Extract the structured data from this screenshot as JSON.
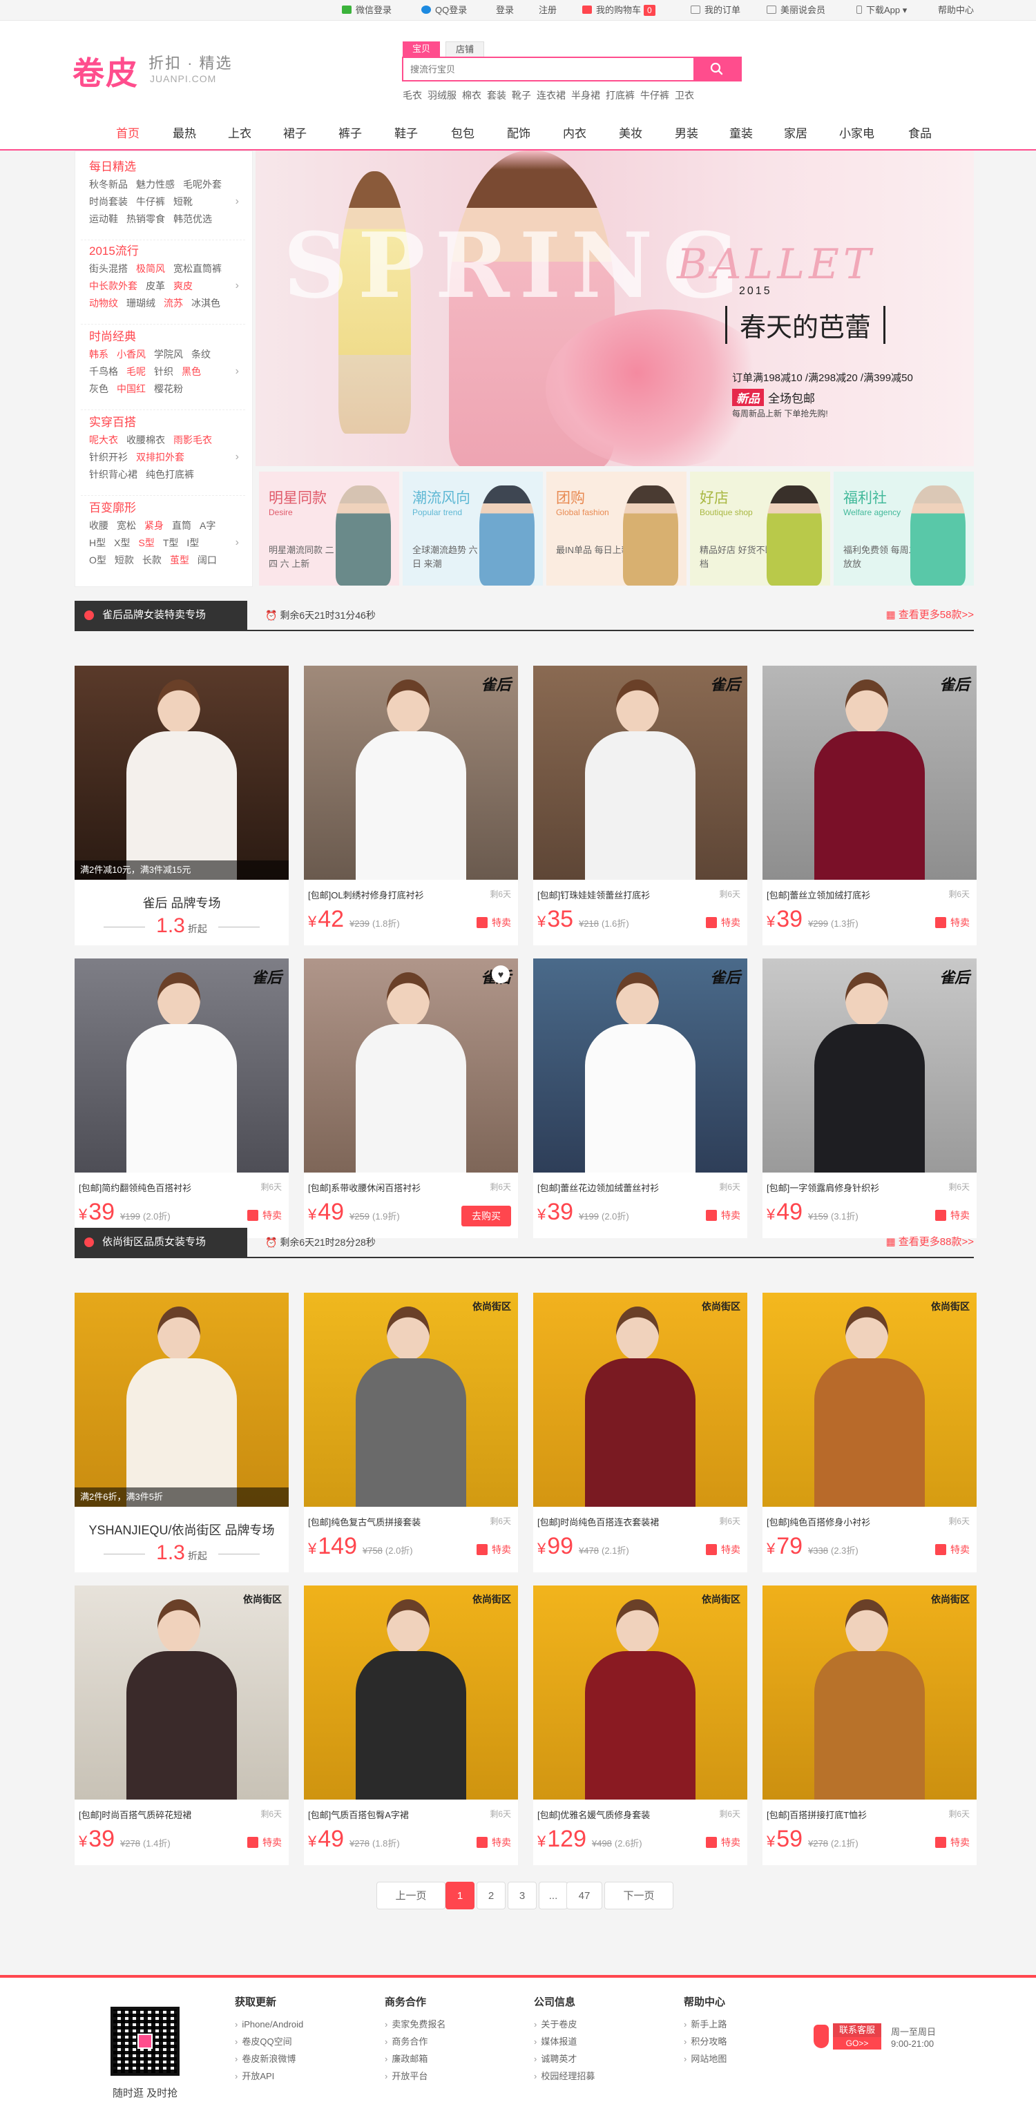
{
  "topbar": {
    "wechat_login": "微信登录",
    "qq_login": "QQ登录",
    "login": "登录",
    "register": "注册",
    "cart": "我的购物车",
    "cart_count": "0",
    "orders": "我的订单",
    "merchant": "美丽说会员",
    "download_app": "下载App",
    "help": "帮助中心",
    "colors": {
      "wechat": "#3bb33b",
      "qq": "#1d8ae0",
      "cart": "#ff464e"
    }
  },
  "header": {
    "logo": "卷皮",
    "slogan": "折扣 · 精选",
    "logo_en": "JUANPI.COM",
    "search_tabs": [
      "宝贝",
      "店铺"
    ],
    "search_placeholder": "搜流行宝贝",
    "hot_words": [
      "毛衣",
      "羽绒服",
      "棉衣",
      "套装",
      "靴子",
      "连衣裙",
      "半身裙",
      "打底裤",
      "牛仔裤",
      "卫衣"
    ],
    "brand_color": "#ff4d8d"
  },
  "nav": {
    "items": [
      "首页",
      "最热",
      "上衣",
      "裙子",
      "裤子",
      "鞋子",
      "包包",
      "配饰",
      "内衣",
      "美妆",
      "男装",
      "童装",
      "家居",
      "小家电",
      "食品"
    ],
    "active": "首页"
  },
  "sidebar": {
    "groups": [
      {
        "title": "每日精选",
        "rows": [
          [
            "秋冬新品",
            "魅力性感",
            "毛呢外套"
          ],
          [
            "时尚套装",
            "牛仔裤",
            "短靴"
          ],
          [
            "运动鞋",
            "热销零食",
            "韩范优选"
          ]
        ]
      },
      {
        "title": "2015流行",
        "rows": [
          [
            "街头混搭",
            "极简风",
            "宽松直筒裤"
          ],
          [
            "中长款外套",
            "皮革",
            "爽皮"
          ],
          [
            "动物纹",
            "珊瑚绒",
            "流苏",
            "冰淇色"
          ]
        ]
      },
      {
        "title": "时尚经典",
        "rows": [
          [
            "韩系",
            "小香风",
            "学院风",
            "条纹"
          ],
          [
            "千鸟格",
            "毛呢",
            "针织",
            "黑色"
          ],
          [
            "灰色",
            "中国红",
            "樱花粉"
          ]
        ]
      },
      {
        "title": "实穿百搭",
        "rows": [
          [
            "呢大衣",
            "收腰棉衣",
            "雨影毛衣"
          ],
          [
            "针织开衫",
            "双排扣外套"
          ],
          [
            "针织背心裙",
            "纯色打底裤"
          ]
        ]
      },
      {
        "title": "百变廓形",
        "rows": [
          [
            "收腰",
            "宽松",
            "紧身",
            "直筒",
            "A字"
          ],
          [
            "H型",
            "X型",
            "S型",
            "T型",
            "I型"
          ],
          [
            "O型",
            "短款",
            "长款",
            "茧型",
            "阔口"
          ]
        ]
      }
    ],
    "highlights": [
      "极简风",
      "中长款外套",
      "爽皮",
      "动物纹",
      "流苏",
      "韩系",
      "小香风",
      "毛呢",
      "黑色",
      "中国红",
      "呢大衣",
      "雨影毛衣",
      "双排扣外套",
      "紧身",
      "S型",
      "茧型"
    ]
  },
  "banner": {
    "big_text": "SPRING",
    "script_text": "BALLET",
    "year": "2015",
    "cn_title": "春天的芭蕾",
    "order_line": "订单满198减10 /满298减20 /满399减50",
    "new_tag": "新品",
    "new_text": "全场包邮",
    "daily_note": "每周新品上新 下单抢先购!"
  },
  "tiles": [
    {
      "title": "明星同款",
      "en": "Desire",
      "desc": "明星潮流同款 二 四 六 上新",
      "bg": "#fbe6ea",
      "title_color": "#e05a6a"
    },
    {
      "title": "潮流风向",
      "en": "Popular trend",
      "desc": "全球潮流趋势 六 日 来潮",
      "bg": "#e6f3f8",
      "title_color": "#5fb8d4"
    },
    {
      "title": "团购",
      "en": "Global fashion",
      "desc": "最IN单品 每日上新",
      "bg": "#fbece0",
      "title_color": "#e88a52"
    },
    {
      "title": "好店",
      "en": "Boutique shop",
      "desc": "精品好店 好货不断档",
      "bg": "#f2f5dc",
      "title_color": "#a9b843"
    },
    {
      "title": "福利社",
      "en": "Welfare agency",
      "desc": "福利免费领 每周二放放",
      "bg": "#e3f6f1",
      "title_color": "#42b99a"
    }
  ],
  "section1": {
    "name": "雀后品牌女装特卖专场",
    "countdown": "剩余6天21时31分46秒",
    "more": "查看更多58款>>",
    "brand_card": {
      "band": "满2件减10元，满3件减15元",
      "brand": "雀后 品牌专场",
      "discount": "1.3",
      "discount_unit": "折起"
    },
    "products": [
      {
        "title": "[包邮]OL刺绣衬修身打底衬衫",
        "remain": "剩6天",
        "price": "42",
        "orig": "¥239",
        "disc": "(1.8折)",
        "badge": "特卖"
      },
      {
        "title": "[包邮]钉珠娃娃领蕾丝打底衫",
        "remain": "剩6天",
        "price": "35",
        "orig": "¥218",
        "disc": "(1.6折)",
        "badge": "特卖"
      },
      {
        "title": "[包邮]蕾丝立领加绒打底衫",
        "remain": "剩6天",
        "price": "39",
        "orig": "¥299",
        "disc": "(1.3折)",
        "badge": "特卖"
      },
      {
        "title": "[包邮]简约翻领纯色百搭衬衫",
        "remain": "剩6天",
        "price": "39",
        "orig": "¥199",
        "disc": "(2.0折)",
        "badge": "特卖"
      },
      {
        "title": "[包邮]系带收腰休闲百搭衬衫",
        "remain": "剩6天",
        "price": "49",
        "orig": "¥259",
        "disc": "(1.9折)",
        "badge": "去购买"
      },
      {
        "title": "[包邮]蕾丝花边领加绒蕾丝衬衫",
        "remain": "剩6天",
        "price": "39",
        "orig": "¥199",
        "disc": "(2.0折)",
        "badge": "特卖"
      },
      {
        "title": "[包邮]一字领露肩修身针织衫",
        "remain": "剩6天",
        "price": "49",
        "orig": "¥159",
        "disc": "(3.1折)",
        "badge": "特卖"
      }
    ],
    "logo": "雀后"
  },
  "section2": {
    "name": "依尚街区品质女装专场",
    "countdown": "剩余6天21时28分28秒",
    "more": "查看更多88款>>",
    "brand_card": {
      "band": "满2件6折，满3件5折",
      "brand": "YSHANJIEQU/依尚街区 品牌专场",
      "discount": "1.3",
      "discount_unit": "折起"
    },
    "products": [
      {
        "title": "[包邮]纯色复古气质拼接套装",
        "remain": "剩6天",
        "price": "149",
        "orig": "¥758",
        "disc": "(2.0折)",
        "badge": "特卖"
      },
      {
        "title": "[包邮]时尚纯色百搭连衣套装裙",
        "remain": "剩6天",
        "price": "99",
        "orig": "¥478",
        "disc": "(2.1折)",
        "badge": "特卖"
      },
      {
        "title": "[包邮]纯色百搭修身小衬衫",
        "remain": "剩6天",
        "price": "79",
        "orig": "¥338",
        "disc": "(2.3折)",
        "badge": "特卖"
      },
      {
        "title": "[包邮]时尚百搭气质碎花短裙",
        "remain": "剩6天",
        "price": "39",
        "orig": "¥278",
        "disc": "(1.4折)",
        "badge": "特卖"
      },
      {
        "title": "[包邮]气质百搭包臀A字裙",
        "remain": "剩6天",
        "price": "49",
        "orig": "¥278",
        "disc": "(1.8折)",
        "badge": "特卖"
      },
      {
        "title": "[包邮]优雅名媛气质修身套装",
        "remain": "剩6天",
        "price": "129",
        "orig": "¥498",
        "disc": "(2.6折)",
        "badge": "特卖"
      },
      {
        "title": "[包邮]百搭拼接打底T恤衫",
        "remain": "剩6天",
        "price": "59",
        "orig": "¥278",
        "disc": "(2.1折)",
        "badge": "特卖"
      }
    ],
    "logo": "依尚街区"
  },
  "pagination": {
    "prev": "上一页",
    "pages": [
      "1",
      "2",
      "3",
      "...",
      "47"
    ],
    "current": "1",
    "next": "下一页"
  },
  "footer": {
    "qr_caption": "随时逛 及时抢",
    "columns": [
      {
        "title": "获取更新",
        "items": [
          "iPhone/Android",
          "卷皮QQ空间",
          "卷皮新浪微博",
          "开放API"
        ]
      },
      {
        "title": "商务合作",
        "items": [
          "卖家免费报名",
          "商务合作",
          "廉政邮箱",
          "开放平台"
        ]
      },
      {
        "title": "公司信息",
        "items": [
          "关于卷皮",
          "媒体报道",
          "诚聘英才",
          "校园经理招募"
        ]
      },
      {
        "title": "帮助中心",
        "items": [
          "新手上路",
          "积分攻略",
          "网站地图"
        ]
      }
    ],
    "service_label": "联系客服",
    "service_go": "GO>>",
    "service_days": "周一至周日",
    "service_hours": "9:00-21:00"
  }
}
